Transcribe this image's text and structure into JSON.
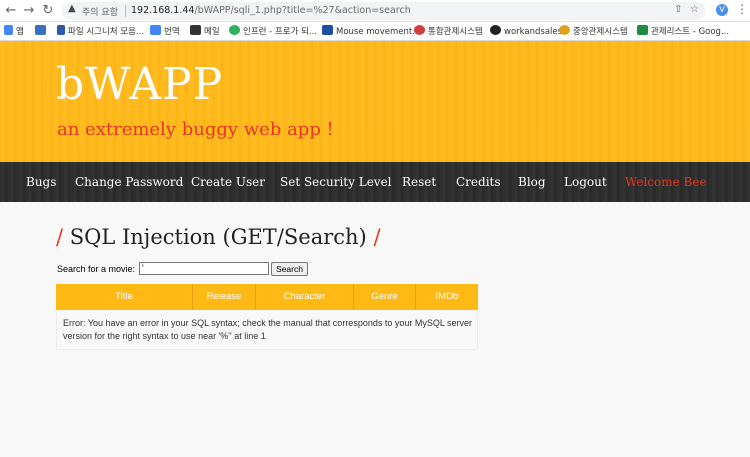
{
  "browser": {
    "security_warning": "주의 요함",
    "url_host": "192.168.1.44",
    "url_path": "/bWAPP/sqli_1.php?title=%27&action=search",
    "bookmarks": [
      {
        "label": "앱",
        "color": "#4285f4"
      },
      {
        "label": "",
        "color": "#3a6fc4"
      },
      {
        "label": "파일 시그니처 모음...",
        "color": "#2a5aa8"
      },
      {
        "label": "번역",
        "color": "#4285f4"
      },
      {
        "label": "메일",
        "color": "#333333"
      },
      {
        "label": "인프런 - 프로가 되...",
        "color": "#2fb05a"
      },
      {
        "label": "Mouse movement...",
        "color": "#1f4fa0"
      },
      {
        "label": "통합관제시스템",
        "color": "#d23c3c"
      },
      {
        "label": "workandsales",
        "color": "#222222"
      },
      {
        "label": "중앙관제시스템",
        "color": "#e0a21a"
      },
      {
        "label": "관제리스트 - Goog...",
        "color": "#1e8e3e"
      }
    ]
  },
  "header": {
    "logo": "bWAPP",
    "tagline": "an extremely buggy web app !"
  },
  "menu": [
    {
      "label": "Bugs"
    },
    {
      "label": "Change Password"
    },
    {
      "label": "Create User"
    },
    {
      "label": "Set Security Level"
    },
    {
      "label": "Reset"
    },
    {
      "label": "Credits"
    },
    {
      "label": "Blog"
    },
    {
      "label": "Logout"
    },
    {
      "label": "Welcome Bee"
    }
  ],
  "main": {
    "title_slash": "/",
    "title": "SQL Injection (GET/Search)",
    "search_label": "Search for a movie:",
    "search_value": "'",
    "search_button": "Search",
    "columns": [
      "Title",
      "Release",
      "Character",
      "Genre",
      "IMDb"
    ],
    "error_message": "Error: You have an error in your SQL syntax; check the manual that corresponds to your MySQL server version for the right syntax to use near '%'' at line 1"
  },
  "colors": {
    "header_yellow": "#ffb91e",
    "accent_red": "#e5381f",
    "menubar_dark": "#2d2d2d"
  }
}
